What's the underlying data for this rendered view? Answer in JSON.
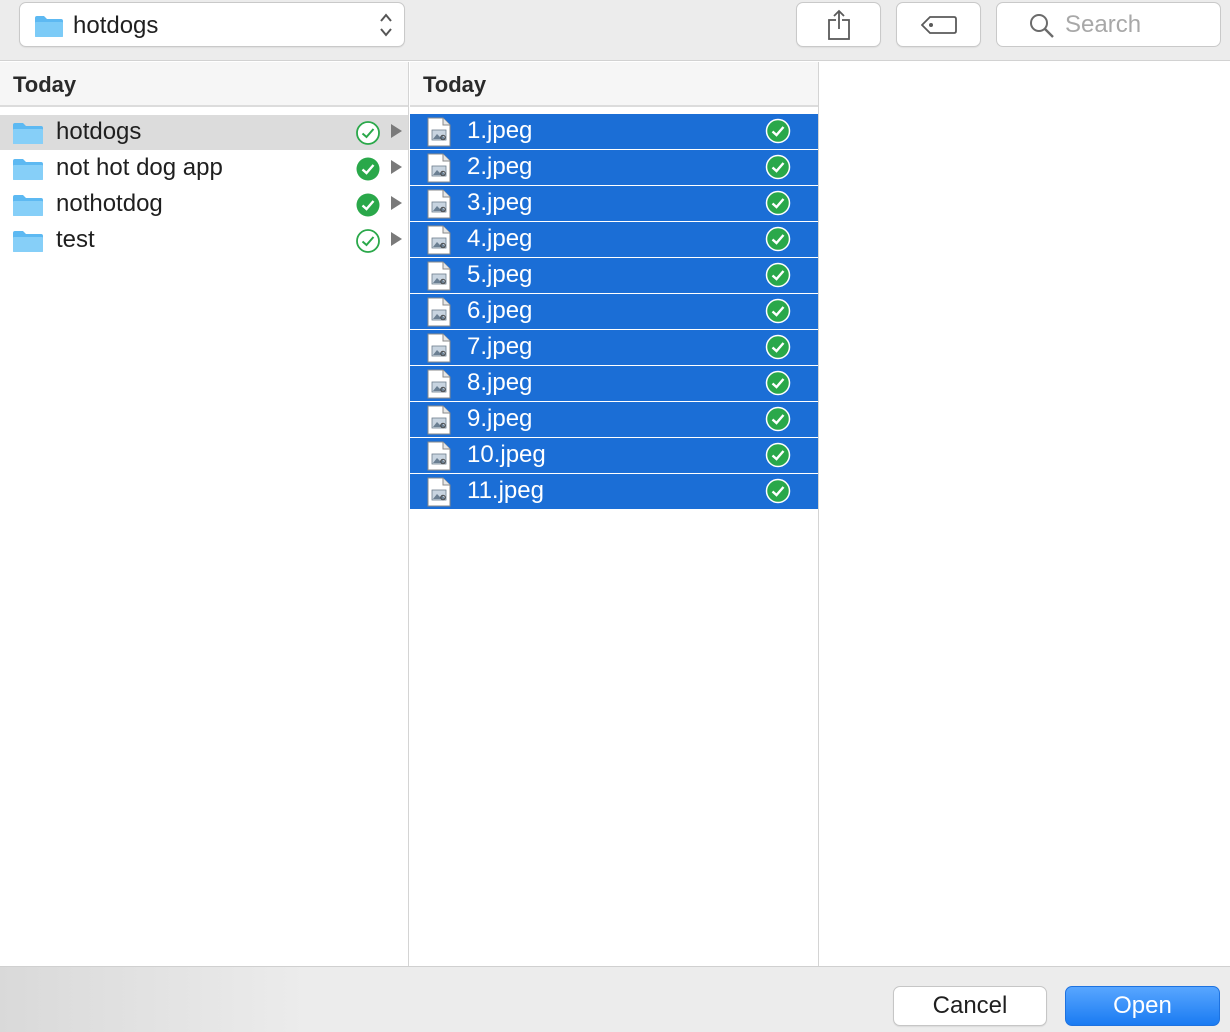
{
  "toolbar": {
    "path_label": "hotdogs",
    "search_placeholder": "Search",
    "share_icon": "share-icon",
    "tag_icon": "tag-icon"
  },
  "column1": {
    "header": "Today",
    "items": [
      {
        "label": "hotdogs",
        "status": "synced-outline",
        "selected": true
      },
      {
        "label": "not hot dog app",
        "status": "synced-filled",
        "selected": false
      },
      {
        "label": "nothotdog",
        "status": "synced-filled",
        "selected": false
      },
      {
        "label": "test",
        "status": "synced-outline",
        "selected": false
      }
    ]
  },
  "column2": {
    "header": "Today",
    "files": [
      {
        "label": "1.jpeg"
      },
      {
        "label": "2.jpeg"
      },
      {
        "label": "3.jpeg"
      },
      {
        "label": "4.jpeg"
      },
      {
        "label": "5.jpeg"
      },
      {
        "label": "6.jpeg"
      },
      {
        "label": "7.jpeg"
      },
      {
        "label": "8.jpeg"
      },
      {
        "label": "9.jpeg"
      },
      {
        "label": "10.jpeg"
      },
      {
        "label": "11.jpeg"
      }
    ]
  },
  "buttons": {
    "cancel": "Cancel",
    "open": "Open"
  },
  "colors": {
    "selection_blue": "#1b6ed6",
    "check_green": "#28a745",
    "folder_blue": "#6cc1f5"
  }
}
